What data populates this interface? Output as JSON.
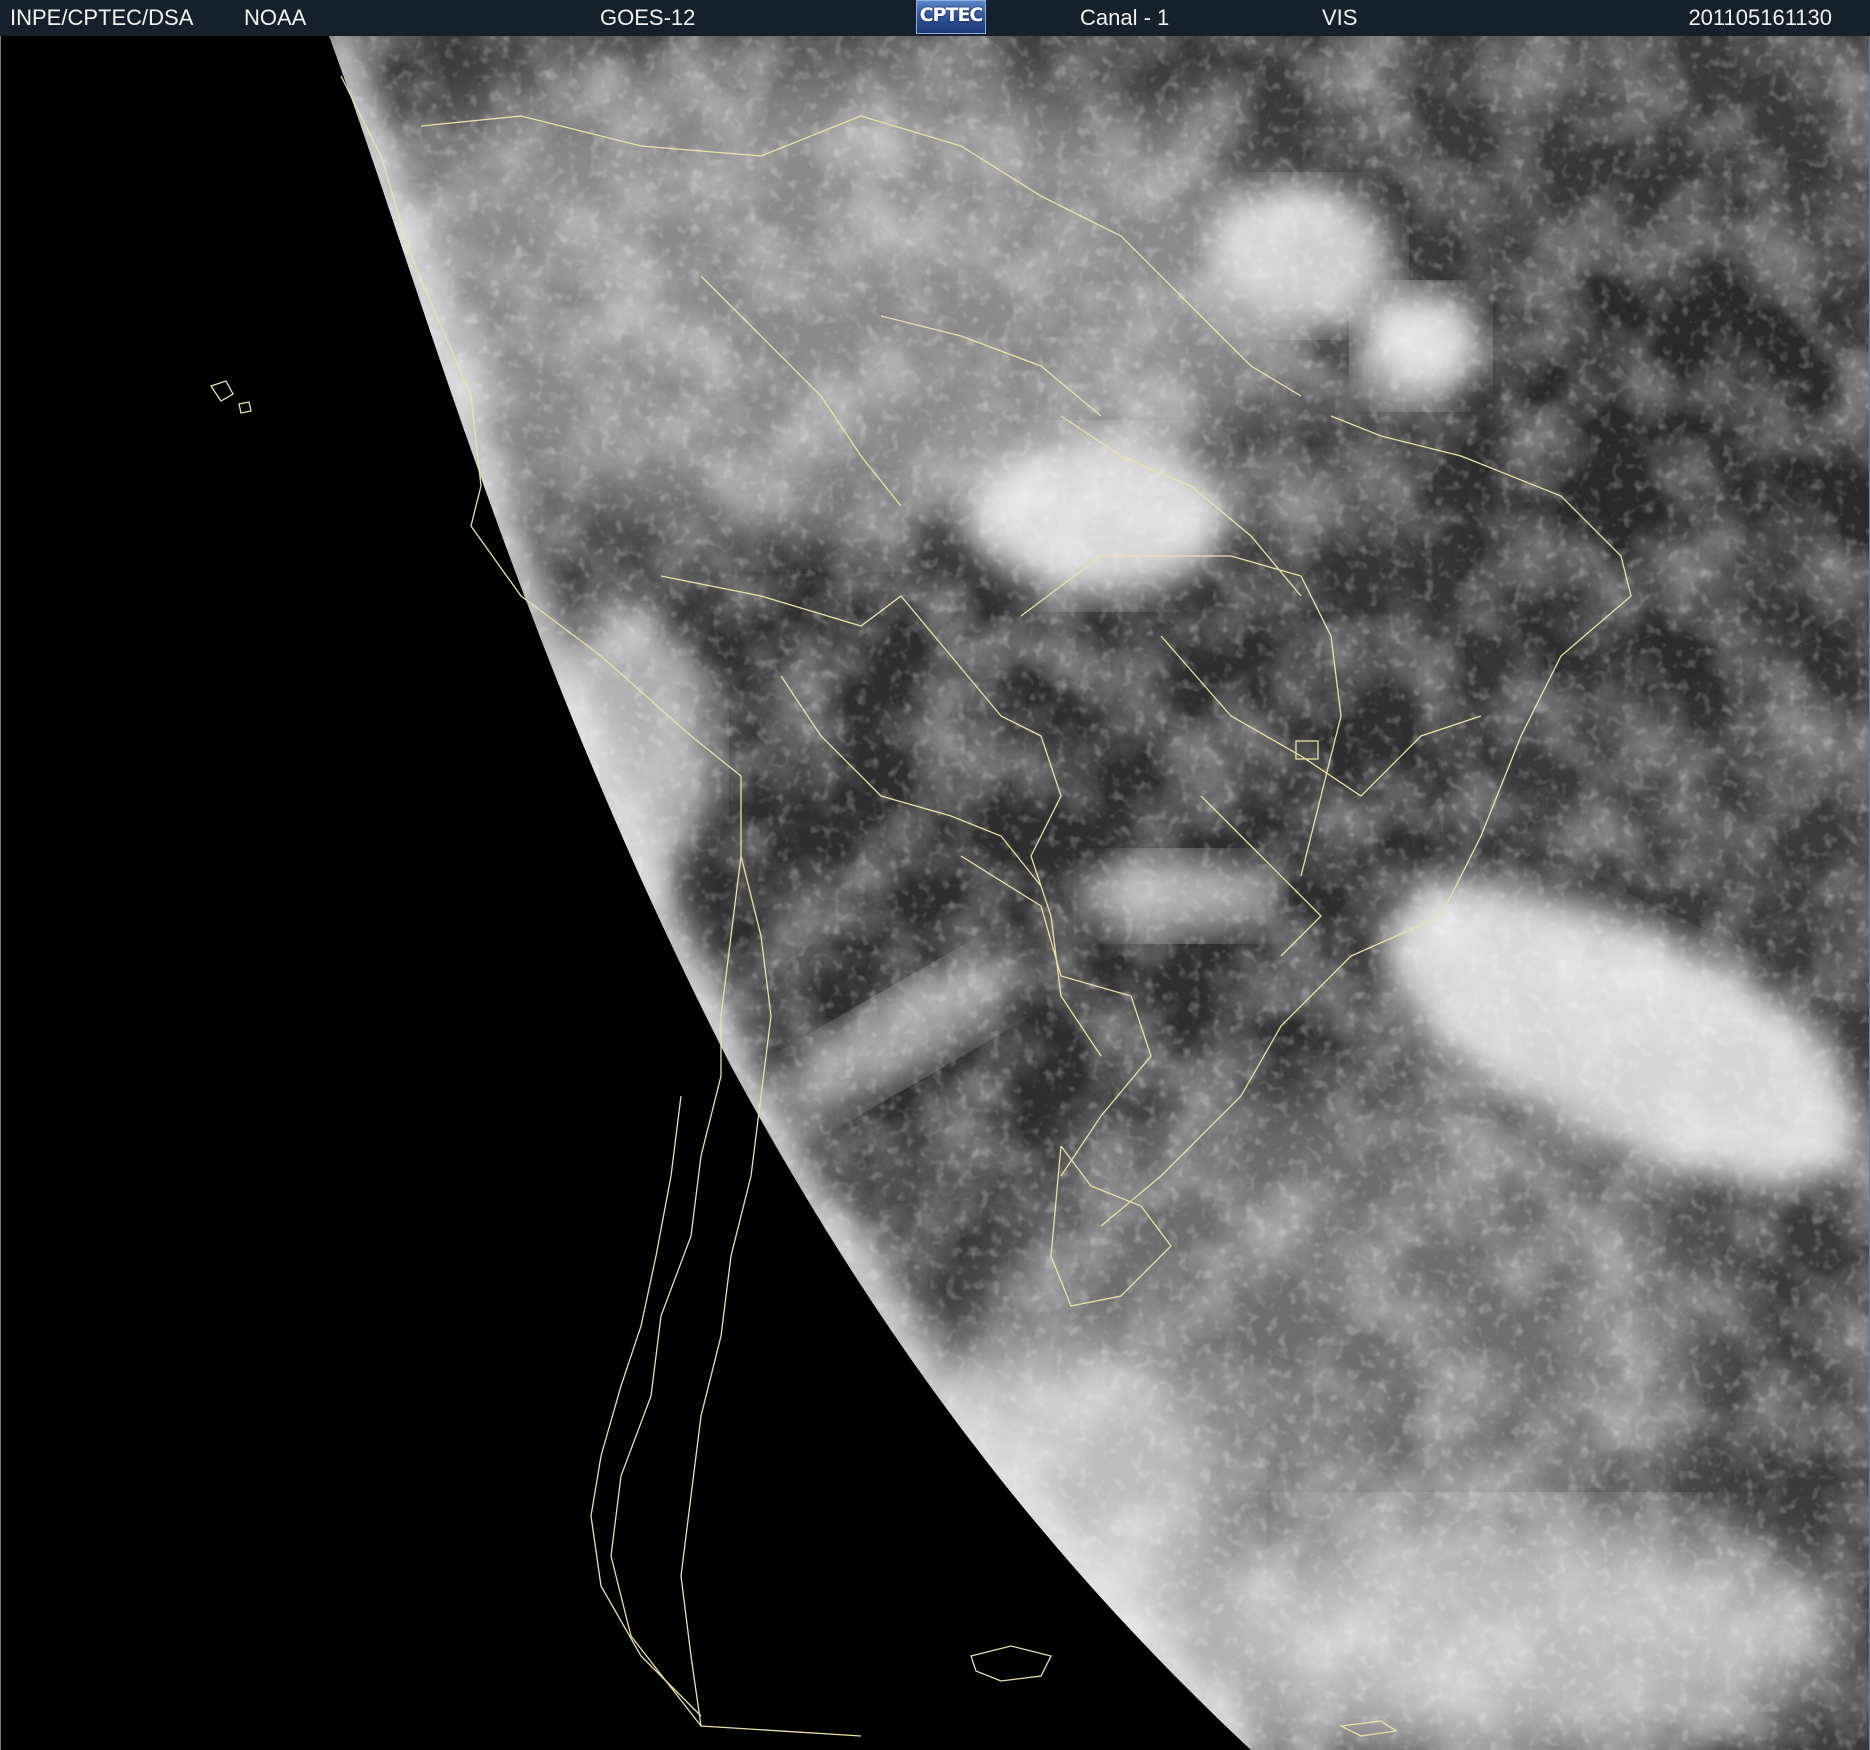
{
  "header": {
    "organization": "INPE/CPTEC/DSA",
    "agency": "NOAA",
    "satellite": "GOES-12",
    "logo_text": "CPTEC",
    "channel": "Canal - 1",
    "band": "VIS",
    "timestamp": "201105161130"
  },
  "image": {
    "description_type": "satellite-visible-imagery",
    "background_color": "#000000",
    "earth_tone_dark": "#2e2e2e",
    "cloud_tone": "#e6e6e6",
    "border_line_color": "#e8e3a6"
  }
}
